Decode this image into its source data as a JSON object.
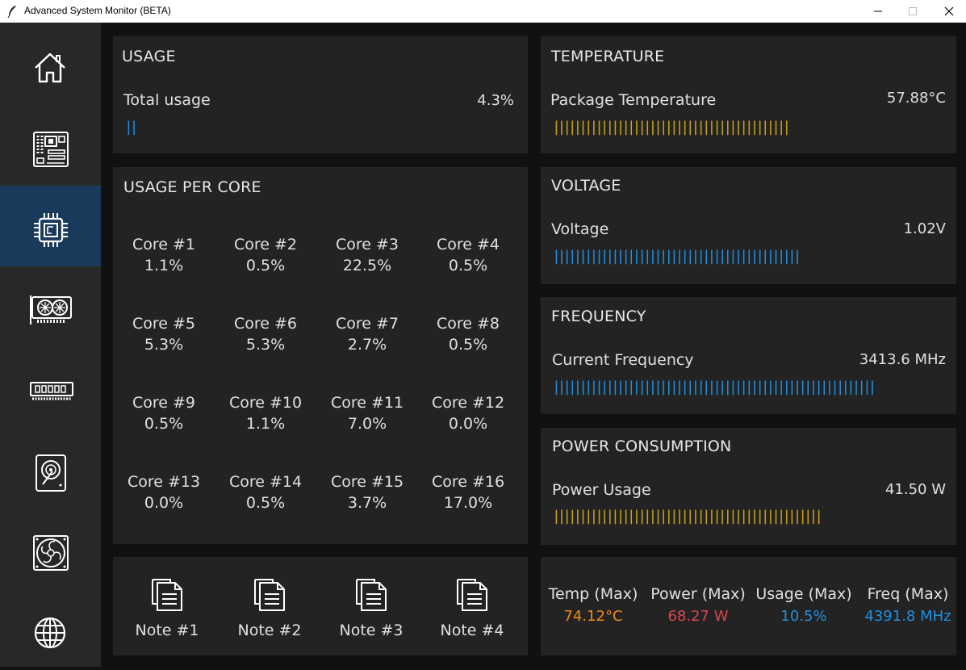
{
  "window": {
    "title": "Advanced System Monitor (BETA)"
  },
  "sidebar": {
    "items": [
      {
        "icon": "home-icon",
        "active": false
      },
      {
        "icon": "motherboard-icon",
        "active": false
      },
      {
        "icon": "cpu-icon",
        "active": true
      },
      {
        "icon": "gpu-icon",
        "active": false
      },
      {
        "icon": "ram-icon",
        "active": false
      },
      {
        "icon": "hdd-icon",
        "active": false
      },
      {
        "icon": "fan-icon",
        "active": false
      },
      {
        "icon": "globe-icon",
        "active": false
      }
    ]
  },
  "usage": {
    "title": "USAGE",
    "label": "Total usage",
    "value": "4.3%",
    "bar": "||"
  },
  "temperature": {
    "title": "TEMPERATURE",
    "label": "Package Temperature",
    "value": "57.88°C",
    "bar": "||||||||||||||||||||||||||||||||||||||||||||"
  },
  "voltage": {
    "title": "VOLTAGE",
    "label": "Voltage",
    "value": "1.02V",
    "bar": "||||||||||||||||||||||||||||||||||||||||||||||"
  },
  "frequency": {
    "title": "FREQUENCY",
    "label": "Current Frequency",
    "value": "3413.6 MHz",
    "bar": "||||||||||||||||||||||||||||||||||||||||||||||||||||||||||||"
  },
  "power": {
    "title": "POWER CONSUMPTION",
    "label": "Power Usage",
    "value": "41.50 W",
    "bar": "||||||||||||||||||||||||||||||||||||||||||||||||||"
  },
  "cores": {
    "title": "USAGE PER CORE",
    "items": [
      {
        "name": "Core #1",
        "value": "1.1%"
      },
      {
        "name": "Core #2",
        "value": "0.5%"
      },
      {
        "name": "Core #3",
        "value": "22.5%"
      },
      {
        "name": "Core #4",
        "value": "0.5%"
      },
      {
        "name": "Core #5",
        "value": "5.3%"
      },
      {
        "name": "Core #6",
        "value": "5.3%"
      },
      {
        "name": "Core #7",
        "value": "2.7%"
      },
      {
        "name": "Core #8",
        "value": "0.5%"
      },
      {
        "name": "Core #9",
        "value": "0.5%"
      },
      {
        "name": "Core #10",
        "value": "1.1%"
      },
      {
        "name": "Core #11",
        "value": "7.0%"
      },
      {
        "name": "Core #12",
        "value": "0.0%"
      },
      {
        "name": "Core #13",
        "value": "0.0%"
      },
      {
        "name": "Core #14",
        "value": "0.5%"
      },
      {
        "name": "Core #15",
        "value": "3.7%"
      },
      {
        "name": "Core #16",
        "value": "17.0%"
      }
    ]
  },
  "notes": [
    {
      "label": "Note #1",
      "icon": "note-icon"
    },
    {
      "label": "Note #2",
      "icon": "note-icon"
    },
    {
      "label": "Note #3",
      "icon": "note-icon"
    },
    {
      "label": "Note #4",
      "icon": "note-icon"
    }
  ],
  "max_stats": [
    {
      "label": "Temp (Max)",
      "value": "74.12°C",
      "color": "#f08a1c"
    },
    {
      "label": "Power (Max)",
      "value": "68.27 W",
      "color": "#d9474f"
    },
    {
      "label": "Usage (Max)",
      "value": "10.5%",
      "color": "#1f8fe0"
    },
    {
      "label": "Freq (Max)",
      "value": "4391.8 MHz",
      "color": "#1f8fe0"
    }
  ],
  "colors": {
    "active_nav": "#1a3a5c",
    "bar_blue": "#1f8fe0",
    "bar_gold": "#c9a21a"
  }
}
